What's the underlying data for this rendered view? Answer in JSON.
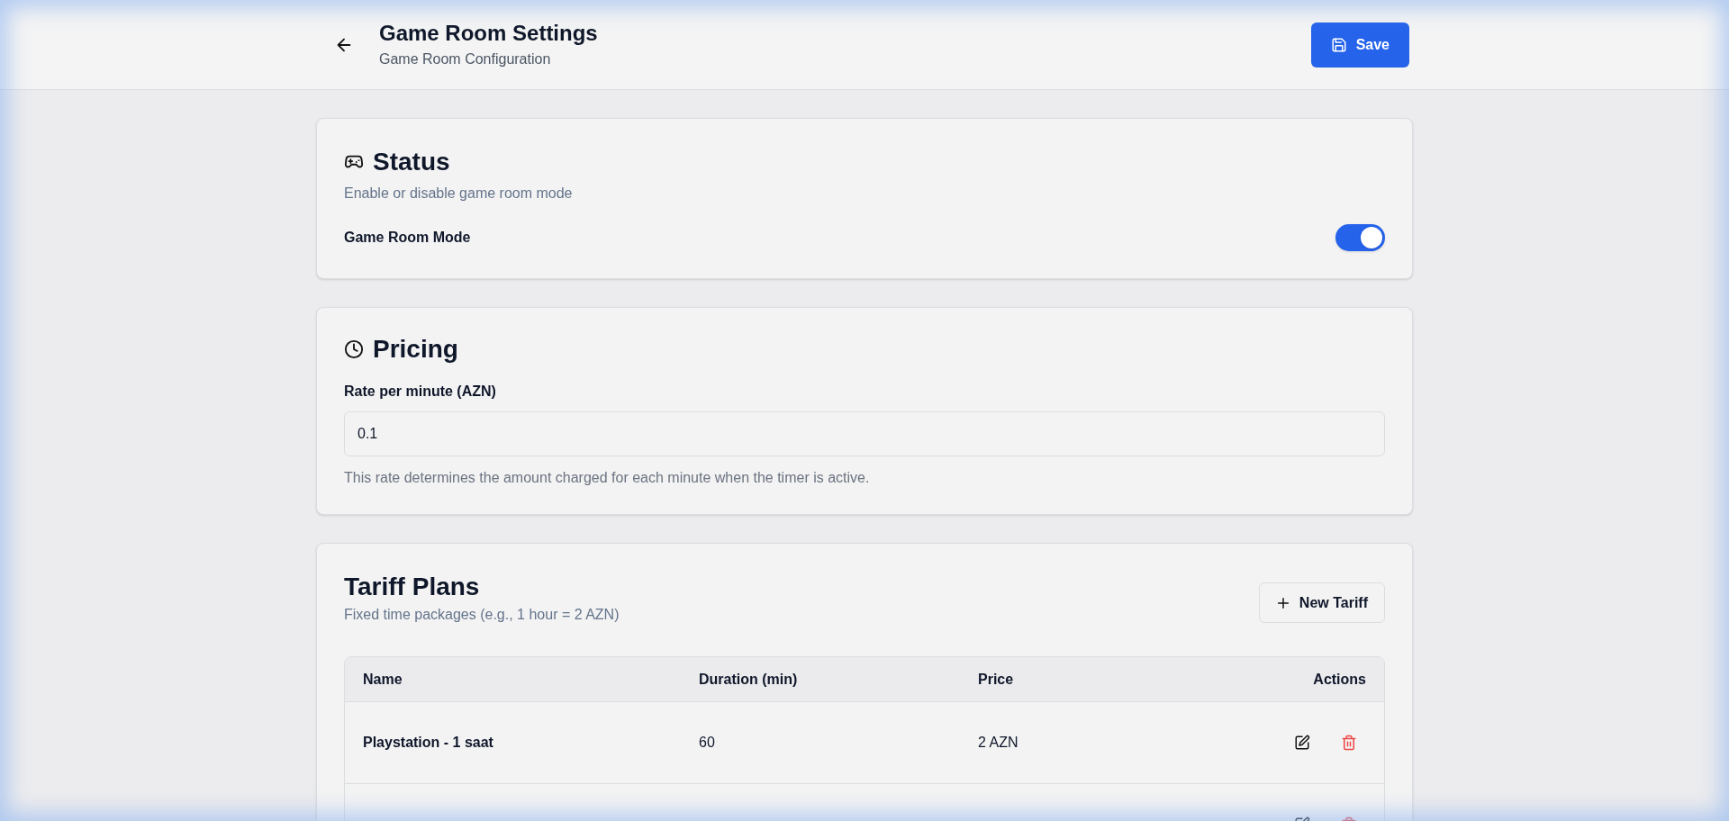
{
  "header": {
    "title": "Game Room Settings",
    "subtitle": "Game Room Configuration",
    "save_button": "Save"
  },
  "status": {
    "title": "Status",
    "description": "Enable or disable game room mode",
    "toggle": {
      "label": "Game Room Mode",
      "on": true
    }
  },
  "pricing": {
    "title": "Pricing",
    "field": {
      "label": "Rate per minute (AZN)",
      "value": "0.1",
      "hint": "This rate determines the amount charged for each minute when the timer is active."
    }
  },
  "tariffs": {
    "title": "Tariff Plans",
    "description": "Fixed time packages (e.g., 1 hour = 2 AZN)",
    "new_button": "New Tariff",
    "table": {
      "columns": [
        "Name",
        "Duration (min)",
        "Price",
        "Actions"
      ],
      "rows": [
        {
          "name": "Playstation - 1 saat",
          "duration": "60",
          "price": "2 AZN"
        },
        {}
      ]
    }
  }
}
